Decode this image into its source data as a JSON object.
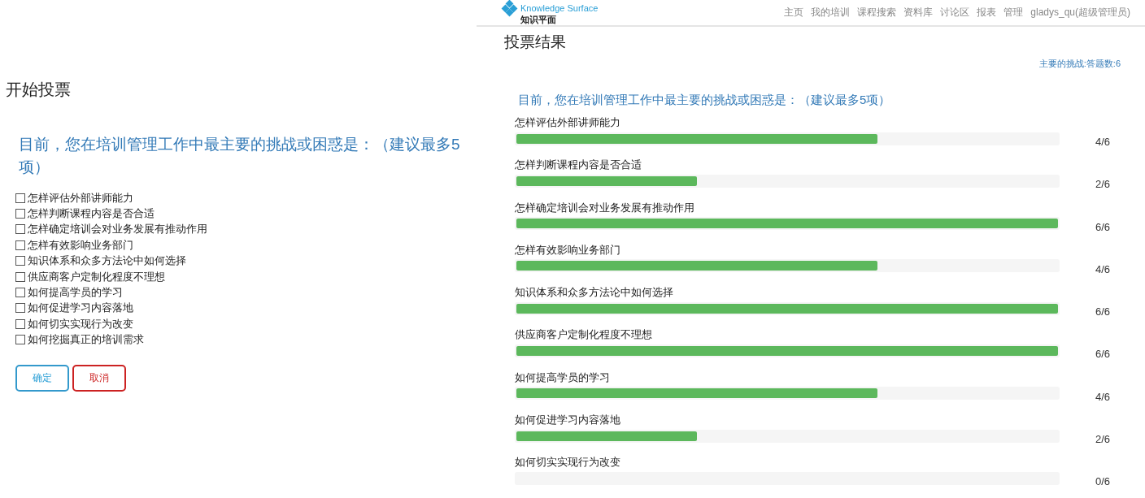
{
  "vote_panel": {
    "title": "开始投票",
    "question": "目前，您在培训管理工作中最主要的挑战或困惑是：（建议最多5项）",
    "options": [
      {
        "label": "怎样评估外部讲师能力",
        "checked": false
      },
      {
        "label": "怎样判断课程内容是否合适",
        "checked": false
      },
      {
        "label": "怎样确定培训会对业务发展有推动作用",
        "checked": false
      },
      {
        "label": "怎样有效影响业务部门",
        "checked": false
      },
      {
        "label": "知识体系和众多方法论中如何选择",
        "checked": false
      },
      {
        "label": "供应商客户定制化程度不理想",
        "checked": false
      },
      {
        "label": "如何提高学员的学习",
        "checked": false
      },
      {
        "label": "如何促进学习内容落地",
        "checked": false
      },
      {
        "label": "如何切实实现行为改变",
        "checked": false
      },
      {
        "label": "如何挖掘真正的培训需求",
        "checked": false
      }
    ],
    "buttons": [
      {
        "label": "确定",
        "kind": "confirm"
      },
      {
        "label": "取消",
        "kind": "cancel"
      }
    ]
  },
  "results_page": {
    "logo": {
      "name": "Knowledge Surface",
      "subtitle": "知识平面"
    },
    "nav": [
      "主页",
      "我的培训",
      "课程搜索",
      "资料库",
      "讨论区",
      "报表",
      "管理",
      "gladys_qu(超级管理员)"
    ],
    "title": "投票结果",
    "summary": "主要的挑战:答题数:6",
    "question": "目前，您在培训管理工作中最主要的挑战或困惑是：（建议最多5项）",
    "results": [
      {
        "label": "怎样评估外部讲师能力",
        "level": 0.667,
        "count": "4/6"
      },
      {
        "label": "怎样判断课程内容是否合适",
        "level": 0.333,
        "count": "2/6"
      },
      {
        "label": "怎样确定培训会对业务发展有推动作用",
        "level": 1,
        "count": "6/6"
      },
      {
        "label": "怎样有效影响业务部门",
        "level": 0.667,
        "count": "4/6"
      },
      {
        "label": "知识体系和众多方法论中如何选择",
        "level": 1,
        "count": "6/6"
      },
      {
        "label": "供应商客户定制化程度不理想",
        "level": 1,
        "count": "6/6"
      },
      {
        "label": "如何提高学员的学习",
        "level": 0.667,
        "count": "4/6"
      },
      {
        "label": "如何促进学习内容落地",
        "level": 0.333,
        "count": "2/6"
      },
      {
        "label": "如何切实实现行为改变",
        "level": 0,
        "count": "0/6"
      }
    ]
  }
}
